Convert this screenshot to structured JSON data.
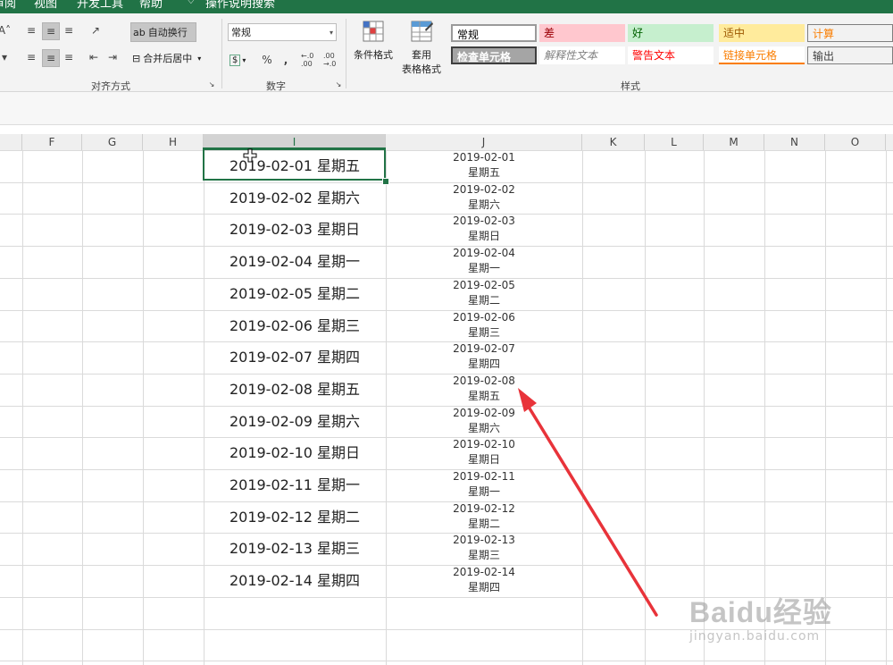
{
  "menu": {
    "items": [
      "审阅",
      "视图",
      "开发工具",
      "帮助",
      "操作说明搜索"
    ]
  },
  "ribbon": {
    "alignment": {
      "wrap_text": "自动换行",
      "merge_center": "合并后居中",
      "group_label": "对齐方式"
    },
    "number": {
      "format_value": "常规",
      "currency_symbol": "$",
      "percent_symbol": "%",
      "comma_symbol": ",",
      "increase_decimal": "←.0 .00",
      "decrease_decimal": ".00 →.0",
      "group_label": "数字"
    },
    "buttons": {
      "conditional_format": "条件格式",
      "table_format_line1": "套用",
      "table_format_line2": "表格格式"
    },
    "styles": {
      "group_label": "样式",
      "items": [
        {
          "label": "常规",
          "bg": "#ffffff",
          "fg": "#000000"
        },
        {
          "label": "差",
          "bg": "#ffc7ce",
          "fg": "#9c0006"
        },
        {
          "label": "好",
          "bg": "#c6efce",
          "fg": "#006100"
        },
        {
          "label": "适中",
          "bg": "#ffeb9c",
          "fg": "#9c5700"
        },
        {
          "label": "计算",
          "bg": "#f2f2f2",
          "fg": "#fa7d00"
        },
        {
          "label": "检查单元格",
          "bg": "#a5a5a5",
          "fg": "#ffffff"
        },
        {
          "label": "解释性文本",
          "bg": "#ffffff",
          "fg": "#7f7f7f"
        },
        {
          "label": "警告文本",
          "bg": "#ffffff",
          "fg": "#ff0000"
        },
        {
          "label": "链接单元格",
          "bg": "#ffffff",
          "fg": "#fa7d00"
        },
        {
          "label": "输出",
          "bg": "#f2f2f2",
          "fg": "#3f3f3f"
        }
      ]
    }
  },
  "columns": [
    "F",
    "G",
    "H",
    "I",
    "J",
    "K",
    "L",
    "M",
    "N",
    "O"
  ],
  "rows": [
    {
      "i": "2019-02-01 星期五",
      "j_date": "2019-02-01",
      "j_day": "星期五"
    },
    {
      "i": "2019-02-02 星期六",
      "j_date": "2019-02-02",
      "j_day": "星期六"
    },
    {
      "i": "2019-02-03 星期日",
      "j_date": "2019-02-03",
      "j_day": "星期日"
    },
    {
      "i": "2019-02-04 星期一",
      "j_date": "2019-02-04",
      "j_day": "星期一"
    },
    {
      "i": "2019-02-05 星期二",
      "j_date": "2019-02-05",
      "j_day": "星期二"
    },
    {
      "i": "2019-02-06 星期三",
      "j_date": "2019-02-06",
      "j_day": "星期三"
    },
    {
      "i": "2019-02-07 星期四",
      "j_date": "2019-02-07",
      "j_day": "星期四"
    },
    {
      "i": "2019-02-08 星期五",
      "j_date": "2019-02-08",
      "j_day": "星期五"
    },
    {
      "i": "2019-02-09 星期六",
      "j_date": "2019-02-09",
      "j_day": "星期六"
    },
    {
      "i": "2019-02-10 星期日",
      "j_date": "2019-02-10",
      "j_day": "星期日"
    },
    {
      "i": "2019-02-11 星期一",
      "j_date": "2019-02-11",
      "j_day": "星期一"
    },
    {
      "i": "2019-02-12 星期二",
      "j_date": "2019-02-12",
      "j_day": "星期二"
    },
    {
      "i": "2019-02-13 星期三",
      "j_date": "2019-02-13",
      "j_day": "星期三"
    },
    {
      "i": "2019-02-14 星期四",
      "j_date": "2019-02-14",
      "j_day": "星期四"
    }
  ],
  "watermark": {
    "line1": "Baidu经验",
    "line2": "jingyan.baidu.com"
  },
  "colors": {
    "excel_green": "#217346",
    "arrow_red": "#e8333a"
  }
}
